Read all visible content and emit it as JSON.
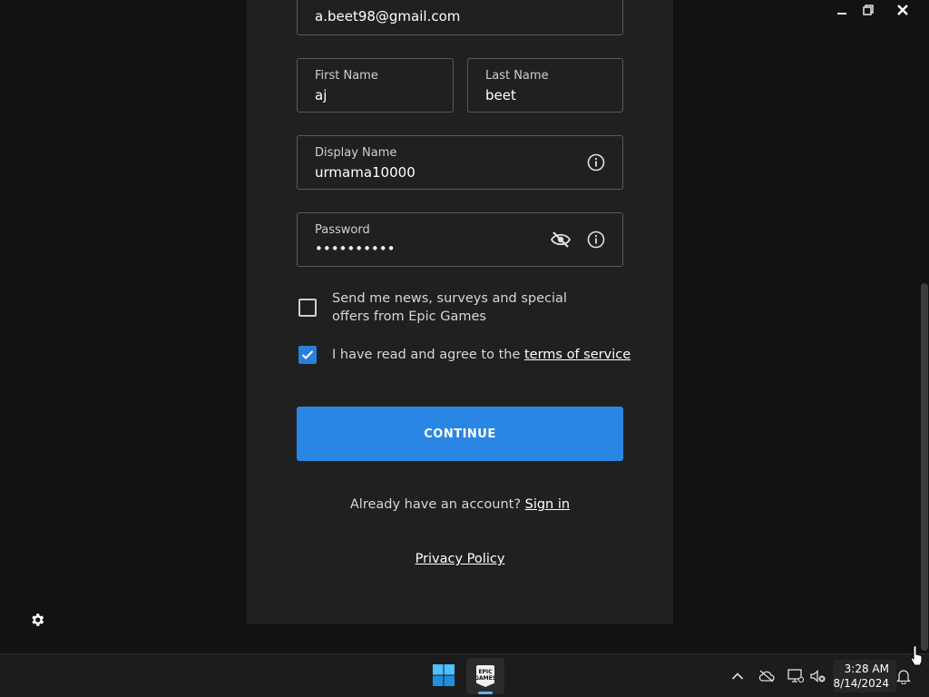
{
  "window": {
    "minimize_icon": "minimize-icon",
    "restore_icon": "restore-icon",
    "close_icon": "close-icon"
  },
  "form": {
    "email": {
      "value": "a.beet98@gmail.com"
    },
    "first_name": {
      "label": "First Name",
      "value": "aj"
    },
    "last_name": {
      "label": "Last Name",
      "value": "beet"
    },
    "display_name": {
      "label": "Display Name",
      "value": "urmama10000"
    },
    "password": {
      "label": "Password",
      "value": "••••••••••"
    },
    "news_checkbox": {
      "label": "Send me news, surveys and special offers from Epic Games",
      "checked": false
    },
    "terms_checkbox": {
      "label_prefix": "I have read and agree to the ",
      "link": "terms of service",
      "checked": true
    },
    "continue_label": "CONTINUE",
    "signin_prefix": "Already have an account? ",
    "signin_link": "Sign in",
    "privacy_link": "Privacy Policy"
  },
  "taskbar": {
    "time": "3:28 AM",
    "date": "8/14/2024",
    "app_label": "EPIC GAMES"
  },
  "colors": {
    "accent": "#2a86e4",
    "card_bg": "#202020",
    "page_bg": "#121212"
  }
}
